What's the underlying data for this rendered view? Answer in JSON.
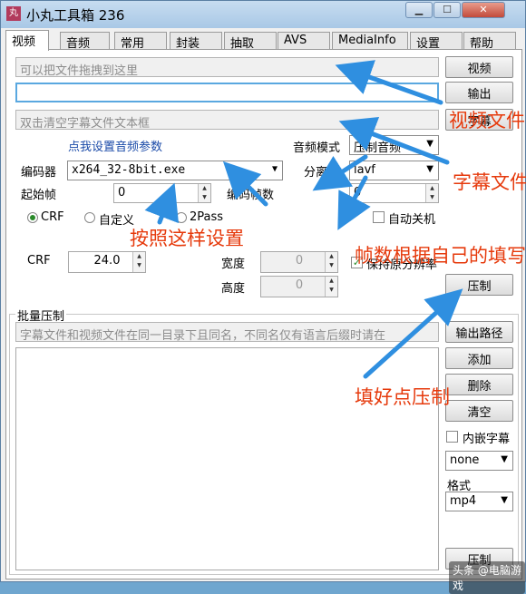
{
  "window": {
    "title": "小丸工具箱 236",
    "app_icon": "丸"
  },
  "tabs": [
    "视频",
    "音频",
    "常用",
    "封装",
    "抽取",
    "AVS",
    "MediaInfo",
    "设置",
    "帮助"
  ],
  "video_panel": {
    "video_input_placeholder": "可以把文件拖拽到这里",
    "video_button": "视频",
    "output_value": "",
    "output_button": "输出",
    "subtitle_placeholder": "双击清空字幕文件文本框",
    "subtitle_button": "字幕",
    "audio_settings_link": "点我设置音频参数",
    "audio_mode_label": "音频模式",
    "audio_mode_value": "压制音频",
    "encoder_label": "编码器",
    "encoder_value": "x264_32-8bit.exe",
    "splitter_label": "分离器",
    "splitter_value": "lavf",
    "start_frame_label": "起始帧",
    "start_frame_value": "0",
    "encode_frames_label": "编码帧数",
    "encode_frames_value": "0",
    "rate_modes": [
      "CRF",
      "自定义",
      "2Pass"
    ],
    "rate_mode_selected": "CRF",
    "auto_shutdown_label": "自动关机",
    "crf_label": "CRF",
    "crf_value": "24.0",
    "width_label": "宽度",
    "width_value": "0",
    "height_label": "高度",
    "height_value": "0",
    "keep_resolution_label": "保持原分辨率"
  },
  "batch": {
    "group_label": "批量压制",
    "hint": "字幕文件和视频文件在同一目录下且同名，不同名仅有语言后缀时请在",
    "output_path_button": "输出路径",
    "add_button": "添加",
    "delete_button": "删除",
    "clear_button": "清空",
    "embed_subtitle_label": "内嵌字幕",
    "subtitle_select_value": "none",
    "format_label": "格式",
    "format_value": "mp4",
    "encode_button": "压制"
  },
  "annotations": {
    "video_file": "视频文件",
    "subtitle_file": "字幕文件",
    "set_like_this": "按照这样设置",
    "frames_note": "帧数根据自己的填写",
    "click_encode": "填好点压制"
  },
  "watermark": "头条 @电脑游戏",
  "colors": {
    "annotation": "#e63a0c",
    "arrow": "#2f8fe0",
    "link": "#1a4aa8"
  }
}
